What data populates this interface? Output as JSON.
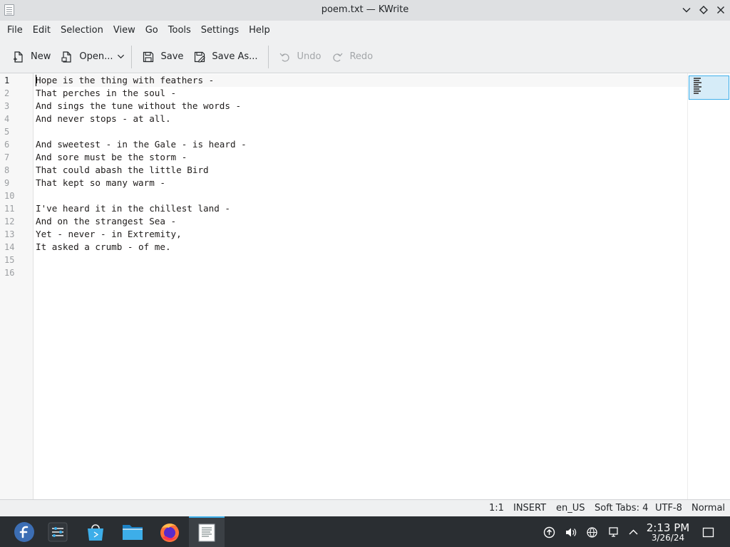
{
  "window": {
    "title": "poem.txt — KWrite"
  },
  "menu": {
    "items": [
      "File",
      "Edit",
      "Selection",
      "View",
      "Go",
      "Tools",
      "Settings",
      "Help"
    ]
  },
  "toolbar": {
    "new_label": "New",
    "open_label": "Open...",
    "save_label": "Save",
    "save_as_label": "Save As...",
    "undo_label": "Undo",
    "redo_label": "Redo"
  },
  "editor": {
    "current_line": 1,
    "lines": [
      "Hope is the thing with feathers -",
      "That perches in the soul -",
      "And sings the tune without the words -",
      "And never stops - at all.",
      "",
      "And sweetest - in the Gale - is heard -",
      "And sore must be the storm -",
      "That could abash the little Bird",
      "That kept so many warm -",
      "",
      "I've heard it in the chillest land -",
      "And on the strangest Sea -",
      "Yet - never - in Extremity,",
      "It asked a crumb - of me.",
      "",
      ""
    ],
    "line_numbers": [
      "1",
      "2",
      "3",
      "4",
      "5",
      "6",
      "7",
      "8",
      "9",
      "10",
      "11",
      "12",
      "13",
      "14",
      "15",
      "16"
    ]
  },
  "status": {
    "cursor": "1:1",
    "mode": "INSERT",
    "language": "en_US",
    "indent": "Soft Tabs: 4",
    "encoding": "UTF-8",
    "input_mode": "Normal"
  },
  "taskbar": {
    "time": "2:13 PM",
    "date": "3/26/24"
  },
  "colors": {
    "accent": "#3daee9",
    "taskbar_bg": "#2a2e32",
    "window_bg": "#eff0f1"
  }
}
